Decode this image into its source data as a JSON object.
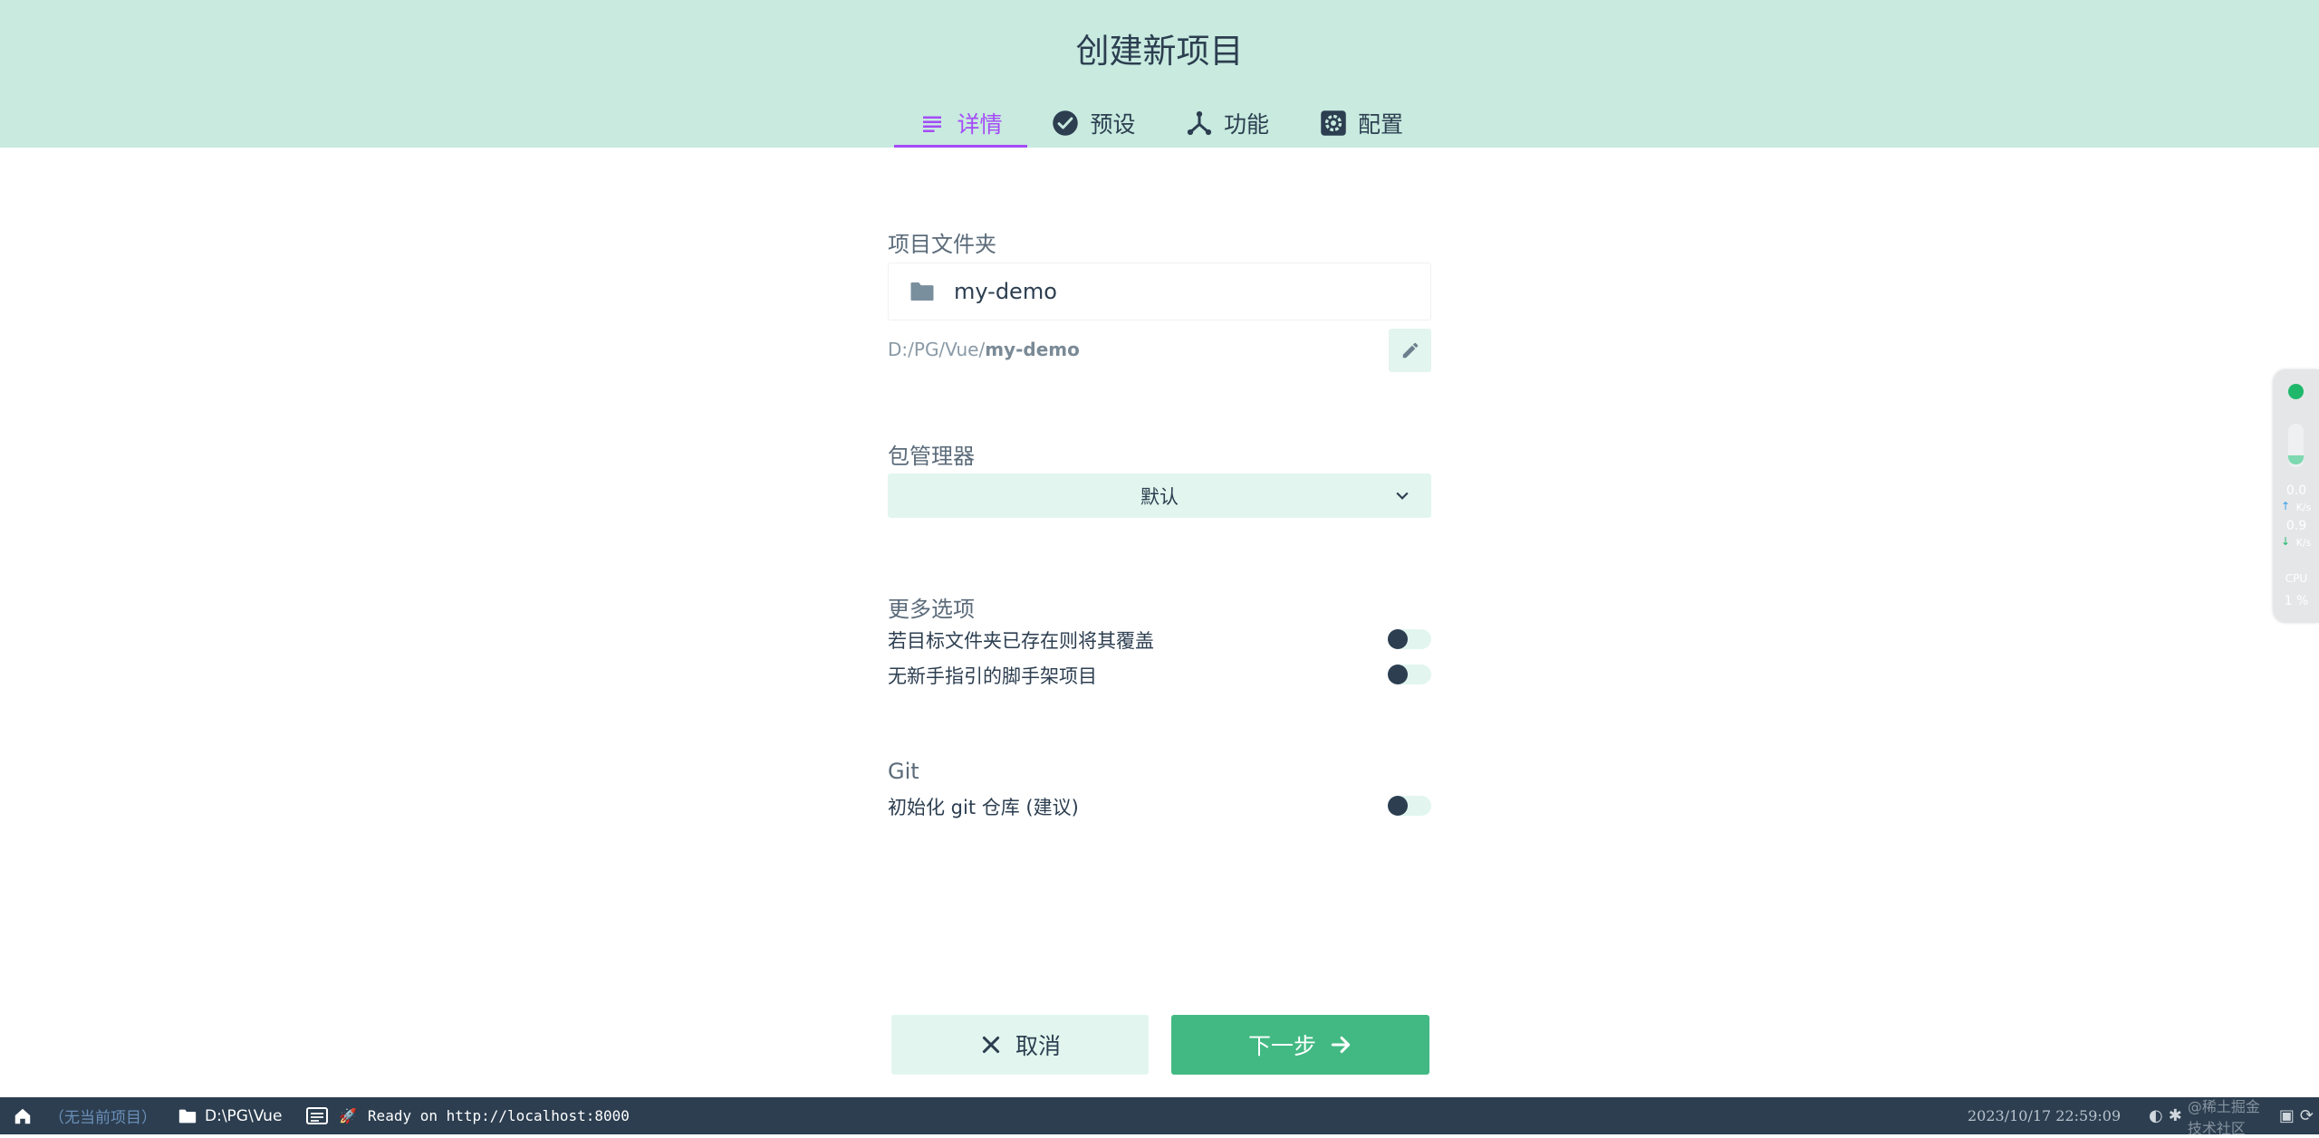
{
  "header": {
    "title": "创建新项目",
    "tabs": [
      {
        "label": "详情",
        "icon": "list-icon",
        "active": true
      },
      {
        "label": "预设",
        "icon": "check-circle-icon",
        "active": false
      },
      {
        "label": "功能",
        "icon": "fork-icon",
        "active": false
      },
      {
        "label": "配置",
        "icon": "gear-icon",
        "active": false
      }
    ]
  },
  "form": {
    "folder": {
      "label": "项目文件夹",
      "value": "my-demo",
      "path_prefix": "D:/PG/Vue/",
      "path_name": "my-demo"
    },
    "package_manager": {
      "label": "包管理器",
      "selected": "默认"
    },
    "more_options": {
      "label": "更多选项",
      "items": [
        {
          "label": "若目标文件夹已存在则将其覆盖",
          "enabled": false
        },
        {
          "label": "无新手指引的脚手架项目",
          "enabled": false
        }
      ]
    },
    "git": {
      "label": "Git",
      "items": [
        {
          "label": "初始化 git 仓库 (建议)",
          "enabled": false
        }
      ]
    }
  },
  "buttons": {
    "cancel_label": "取消",
    "next_label": "下一步"
  },
  "statusbar": {
    "project": "（无当前项目）",
    "folder": "D:\\PG\\Vue",
    "log": "Ready on http://localhost:8000",
    "datetime": "2023/10/17 22:59:09",
    "watermark": "@稀土掘金技术社区"
  },
  "widget": {
    "upload_value": "0.0",
    "upload_unit": "K/s",
    "download_value": "0.9",
    "download_unit": "K/s",
    "cpu_label": "CPU",
    "cpu_value": "1 %"
  },
  "colors": {
    "header_bg": "#c8eadf",
    "accent": "#a44cf6",
    "primary": "#42b983",
    "text": "#2c3e50",
    "light_green": "#e2f6ef",
    "statusbar_bg": "#2c3e50"
  }
}
